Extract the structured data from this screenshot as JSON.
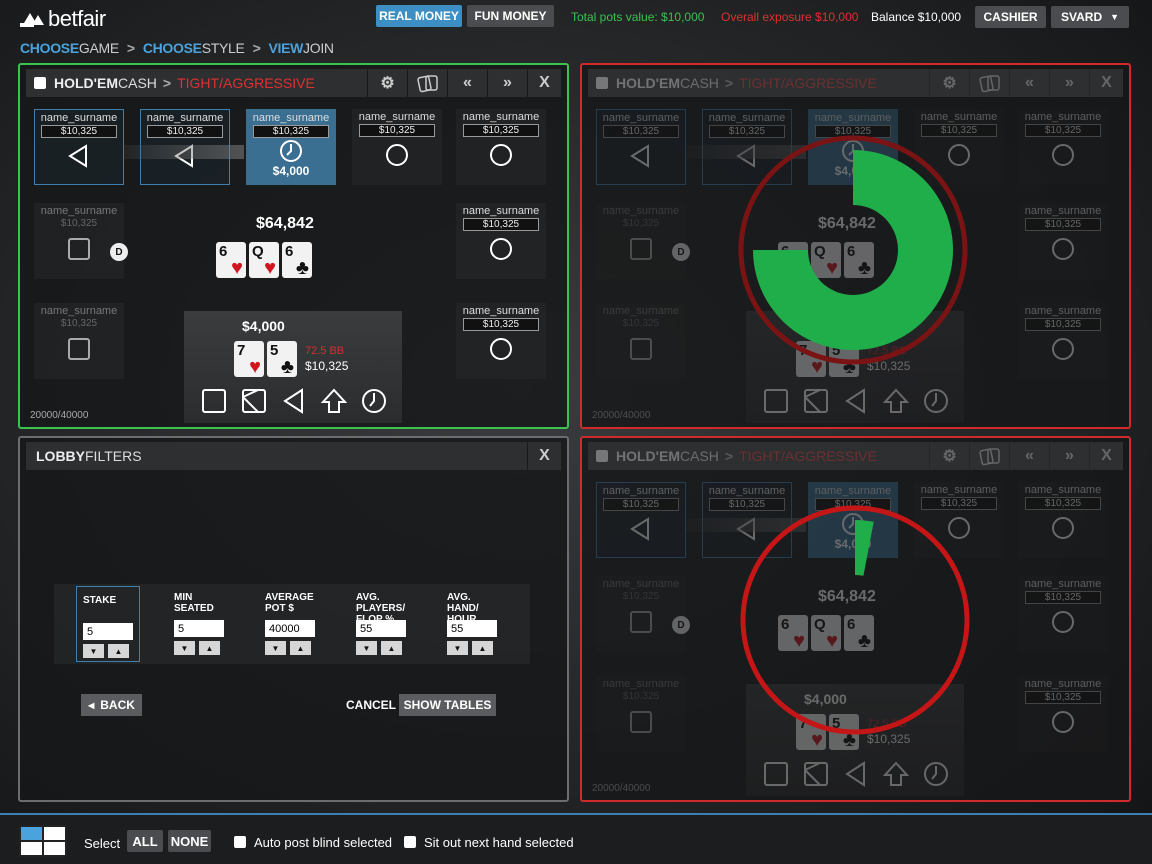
{
  "header": {
    "logo_text": "betfair",
    "real_money": "REAL MONEY",
    "fun_money": "FUN MONEY",
    "total_pots": "Total pots value: $10,000",
    "exposure": "Overall exposure $10,000",
    "balance": "Balance $10,000",
    "cashier": "CASHIER",
    "user": "SVARD"
  },
  "breadcrumb": [
    {
      "bold": "CHOOSE",
      "rest": "GAME"
    },
    {
      "bold": "CHOOSE",
      "rest": "STYLE"
    },
    {
      "bold": "VIEW",
      "rest": "JOIN"
    }
  ],
  "table": {
    "title_bold": "HOLD'EM",
    "title_rest": "CASH",
    "style": "TIGHT/AGGRESSIVE",
    "close": "X",
    "seat_name": "name_surname",
    "seat_stack": "$10,325",
    "bet": "$4,000",
    "pot": "$64,842",
    "dealer": "D",
    "community": [
      {
        "rank": "6",
        "suit": "♥"
      },
      {
        "rank": "Q",
        "suit": "♥"
      },
      {
        "rank": "6",
        "suit": "♣"
      }
    ],
    "hole": [
      {
        "rank": "7",
        "suit": "♥"
      },
      {
        "rank": "5",
        "suit": "♣"
      }
    ],
    "player_bet": "$4,000",
    "bb": "72.5 BB",
    "player_stack": "$10,325",
    "stakes": "20000/40000"
  },
  "filters": {
    "title_bold": "LOBBY",
    "title_rest": "FILTERS",
    "close": "X",
    "fields": [
      {
        "label": "STAKE",
        "value": "5"
      },
      {
        "label": "MIN SEATED",
        "value": "5"
      },
      {
        "label": "AVERAGE POT $",
        "value": "40000"
      },
      {
        "label": "AVG. PLAYERS/ FLOP %",
        "value": "55"
      },
      {
        "label": "AVG. HAND/ HOUR",
        "value": "55"
      }
    ],
    "back": "BACK",
    "cancel": "CANCEL",
    "show_tables": "SHOW TABLES"
  },
  "progress": {
    "top_right_fraction": 0.75,
    "bottom_right_fraction": 0.03
  },
  "bottom": {
    "select": "Select",
    "all": "ALL",
    "none": "NONE",
    "auto_post": "Auto post blind selected",
    "sit_out": "Sit out next hand selected"
  },
  "colors": {
    "accent": "#3d8fc3",
    "active_border": "#3bc24f",
    "inactive_border": "#d22a2a",
    "progress": "#1fae4a"
  }
}
